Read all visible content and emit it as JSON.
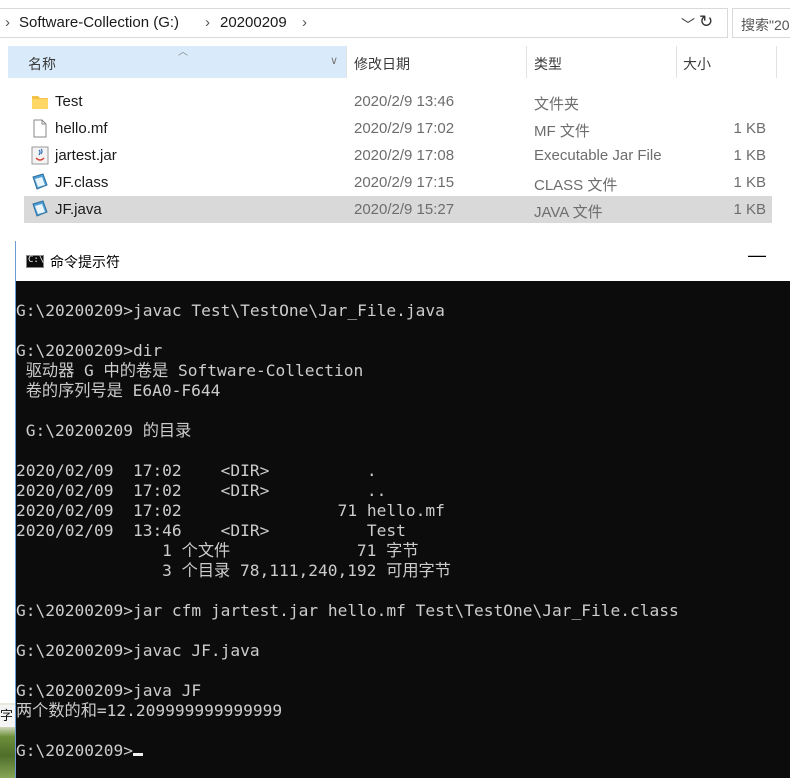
{
  "explorer": {
    "breadcrumb": [
      "Software-Collection (G:)",
      "20200209"
    ],
    "search_placeholder": "搜索\"20",
    "columns": {
      "name": "名称",
      "date": "修改日期",
      "type": "类型",
      "size": "大小"
    },
    "files": [
      {
        "name": "Test",
        "date": "2020/2/9 13:46",
        "type": "文件夹",
        "size": "",
        "icon": "folder-icon"
      },
      {
        "name": "hello.mf",
        "date": "2020/2/9 17:02",
        "type": "MF 文件",
        "size": "1 KB",
        "icon": "file-icon"
      },
      {
        "name": "jartest.jar",
        "date": "2020/2/9 17:08",
        "type": "Executable Jar File",
        "size": "1 KB",
        "icon": "jar-file-icon"
      },
      {
        "name": "JF.class",
        "date": "2020/2/9 17:15",
        "type": "CLASS 文件",
        "size": "1 KB",
        "icon": "class-file-icon"
      },
      {
        "name": "JF.java",
        "date": "2020/2/9 15:27",
        "type": "JAVA 文件",
        "size": "1 KB",
        "icon": "java-file-icon",
        "selected": true
      }
    ]
  },
  "cmd": {
    "title": "命令提示符",
    "icon_label": "C:\\",
    "minimize_glyph": "—",
    "lines": [
      "G:\\20200209>javac Test\\TestOne\\Jar_File.java",
      "",
      "G:\\20200209>dir",
      " 驱动器 G 中的卷是 Software-Collection",
      " 卷的序列号是 E6A0-F644",
      "",
      " G:\\20200209 的目录",
      "",
      "2020/02/09  17:02    <DIR>          .",
      "2020/02/09  17:02    <DIR>          ..",
      "2020/02/09  17:02                71 hello.mf",
      "2020/02/09  13:46    <DIR>          Test",
      "               1 个文件             71 字节",
      "               3 个目录 78,111,240,192 可用字节",
      "",
      "G:\\20200209>jar cfm jartest.jar hello.mf Test\\TestOne\\Jar_File.class",
      "",
      "G:\\20200209>javac JF.java",
      "",
      "G:\\20200209>java JF",
      "两个数的和=12.209999999999999",
      ""
    ],
    "prompt": "G:\\20200209>"
  },
  "desktop": {
    "label": "字"
  }
}
